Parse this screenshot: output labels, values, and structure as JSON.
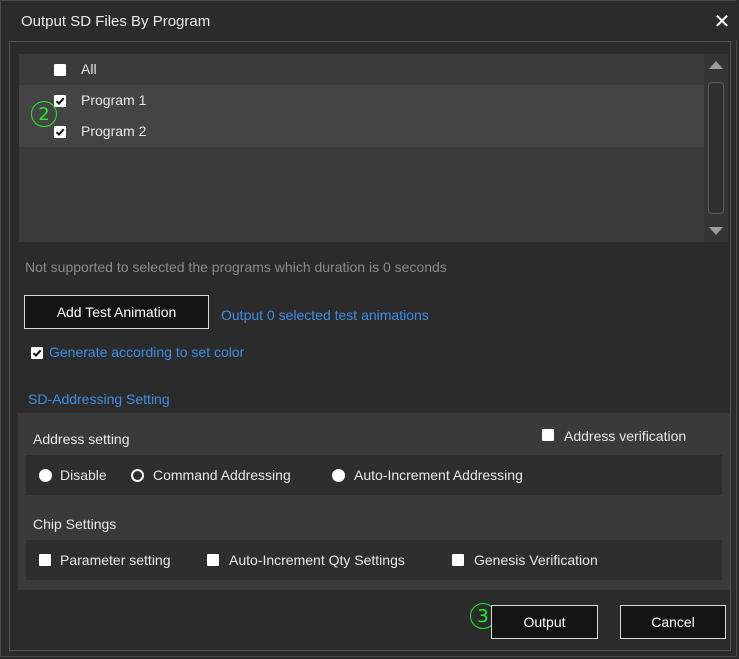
{
  "window": {
    "title": "Output SD Files By Program",
    "close_icon": "close-icon"
  },
  "program_list": {
    "items": [
      {
        "label": "All",
        "checked": false
      },
      {
        "label": "Program 1",
        "checked": true
      },
      {
        "label": "Program 2",
        "checked": true
      }
    ]
  },
  "annotations": {
    "step2": "2",
    "step3": "3",
    "color": "#22ee22"
  },
  "note": "Not supported to selected the programs which duration is 0 seconds",
  "test_animation": {
    "button_label": "Add Test Animation",
    "status": "Output 0 selected test animations"
  },
  "generate_color": {
    "label": "Generate according to set color",
    "checked": true
  },
  "sd_addressing": {
    "section_title": "SD-Addressing Setting",
    "address_setting_label": "Address setting",
    "address_verification": {
      "label": "Address verification",
      "checked": false
    },
    "address_modes": [
      {
        "label": "Disable",
        "selected": true
      },
      {
        "label": "Command Addressing",
        "selected": false
      },
      {
        "label": "Auto-Increment Addressing",
        "selected": true
      }
    ],
    "chip_settings_label": "Chip Settings",
    "chip_options": [
      {
        "label": "Parameter setting",
        "checked": false
      },
      {
        "label": "Auto-Increment Qty Settings",
        "checked": false
      },
      {
        "label": "Genesis Verification",
        "checked": false
      }
    ]
  },
  "footer": {
    "output_label": "Output",
    "cancel_label": "Cancel"
  },
  "colors": {
    "accent": "#3d8fe6",
    "background": "#2b2b2b",
    "list_bg": "#3b3b3b"
  }
}
